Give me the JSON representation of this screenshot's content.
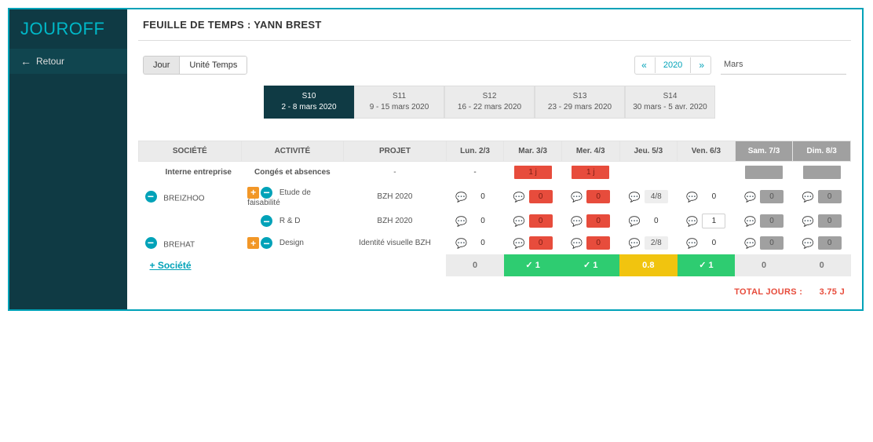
{
  "app": {
    "logo": "JOUROFF"
  },
  "sidebar": {
    "back_label": "Retour"
  },
  "header": {
    "title": "FEUILLE DE TEMPS : YANN BREST"
  },
  "toggle": {
    "jour": "Jour",
    "unite": "Unité Temps"
  },
  "nav": {
    "year": "2020",
    "month": "Mars"
  },
  "weeks": [
    {
      "label": "S10",
      "range": "2 - 8 mars 2020",
      "active": true
    },
    {
      "label": "S11",
      "range": "9 - 15 mars 2020",
      "active": false
    },
    {
      "label": "S12",
      "range": "16 - 22 mars 2020",
      "active": false
    },
    {
      "label": "S13",
      "range": "23 - 29 mars 2020",
      "active": false
    },
    {
      "label": "S14",
      "range": "30 mars - 5 avr. 2020",
      "active": false
    }
  ],
  "columns": {
    "societe": "SOCIÉTÉ",
    "activite": "ACTIVITÉ",
    "projet": "PROJET",
    "days": [
      "Lun. 2/3",
      "Mar. 3/3",
      "Mer. 4/3",
      "Jeu. 5/3",
      "Ven. 6/3",
      "Sam. 7/3",
      "Dim. 8/3"
    ]
  },
  "rows": {
    "absence": {
      "societe": "Interne entreprise",
      "activite": "Congés et absences",
      "projet": "-",
      "days": [
        "-",
        "1 j",
        "1 j",
        "",
        "",
        "-",
        "-"
      ]
    },
    "r1": {
      "societe": "BREIZHOO",
      "activite": "Etude de faisabilité",
      "projet": "BZH 2020",
      "days": [
        "0",
        "0",
        "0",
        "4/8",
        "0",
        "0",
        "0"
      ]
    },
    "r2": {
      "activite": "R & D",
      "projet": "BZH 2020",
      "days": [
        "0",
        "0",
        "0",
        "0",
        "1",
        "0",
        "0"
      ]
    },
    "r3": {
      "societe": "BREHAT",
      "activite": "Design",
      "projet": "Identité visuelle BZH",
      "days": [
        "0",
        "0",
        "0",
        "2/8",
        "0",
        "0",
        "0"
      ]
    }
  },
  "totals": {
    "add_label": "+ Société",
    "days": [
      "0",
      "✓ 1",
      "✓ 1",
      "0.8",
      "✓ 1",
      "0",
      "0"
    ]
  },
  "footer": {
    "label": "TOTAL JOURS :",
    "value": "3.75 J"
  }
}
